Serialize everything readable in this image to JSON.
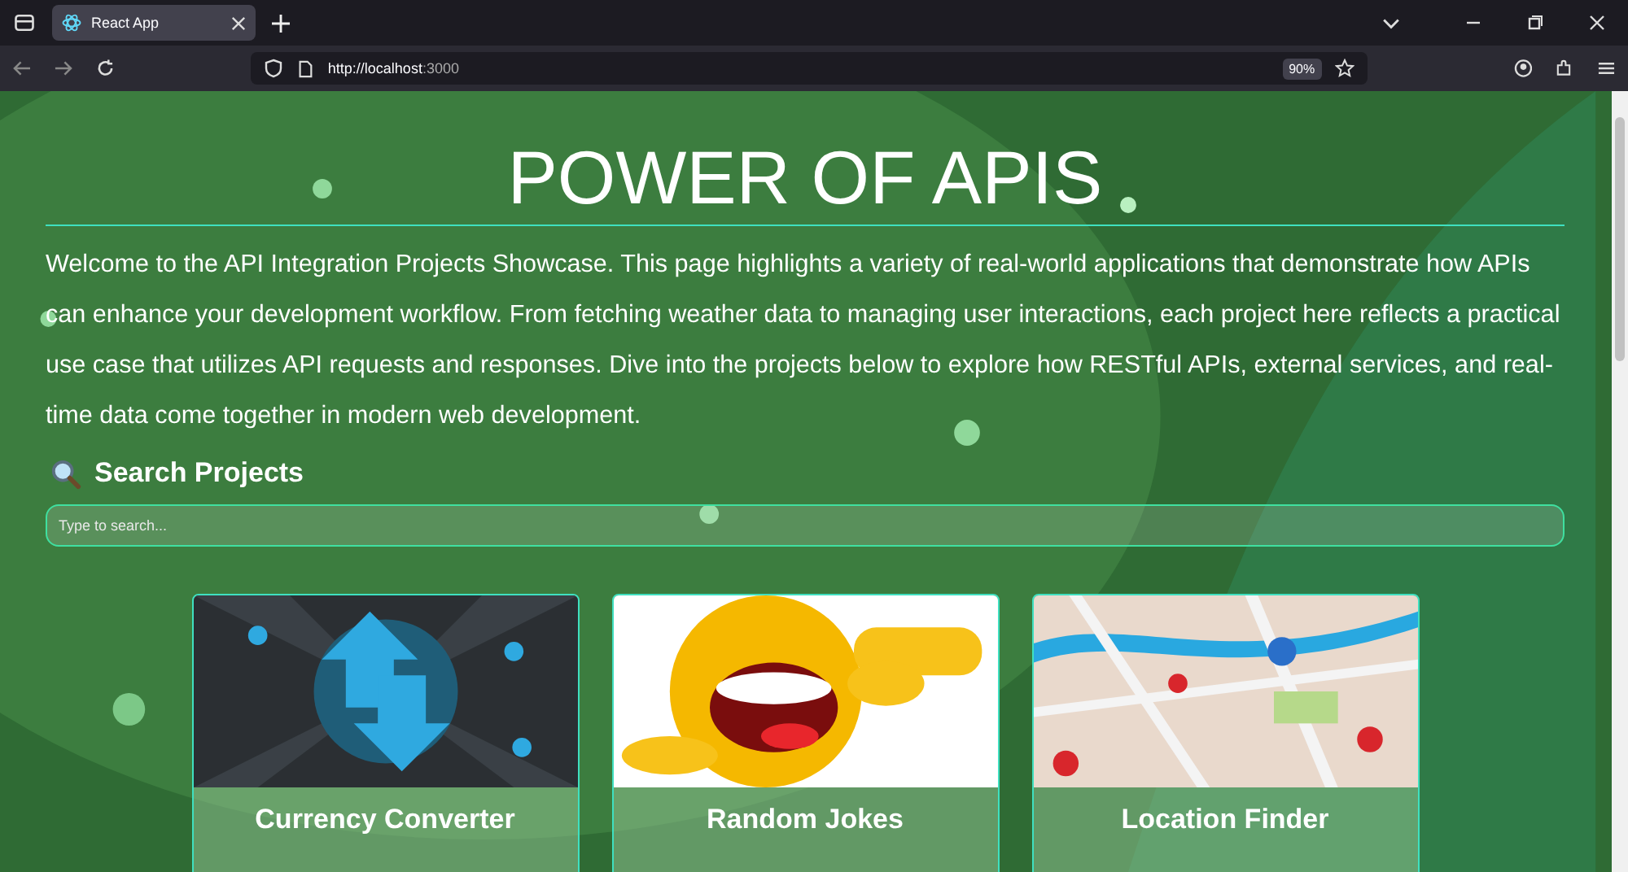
{
  "browser": {
    "tab": {
      "title": "React App",
      "selected": true
    },
    "url_host": "http://localhost",
    "url_port": ":3000",
    "zoom": "90%"
  },
  "page": {
    "title": "POWER OF APIS",
    "intro": "Welcome to the API Integration Projects Showcase. This page highlights a variety of real-world applications that demonstrate how APIs can enhance your development workflow. From fetching weather data to managing user interactions, each project here reflects a practical use case that utilizes API requests and responses. Dive into the projects below to explore how RESTful APIs, external services, and real-time data come together in modern web development.",
    "search_heading": "Search Projects",
    "search": {
      "placeholder": "Type to search..."
    },
    "projects": [
      {
        "title": "Currency Converter"
      },
      {
        "title": "Random Jokes"
      },
      {
        "title": "Location Finder"
      }
    ]
  }
}
